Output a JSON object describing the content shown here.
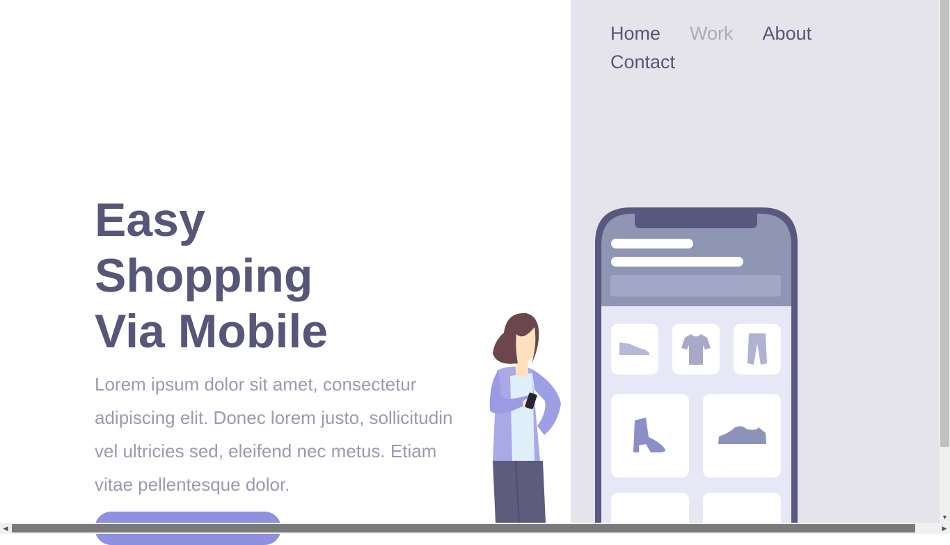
{
  "nav": {
    "items": [
      {
        "label": "Home",
        "active": false
      },
      {
        "label": "Work",
        "active": true
      },
      {
        "label": "About",
        "active": false
      },
      {
        "label": "Contact",
        "active": false
      }
    ]
  },
  "hero": {
    "headline_lines": [
      "Easy",
      "Shopping",
      "Via Mobile"
    ],
    "description": "Lorem ipsum dolor sit amet, consectetur adipiscing elit. Donec lorem justo, sollicitudin vel ultricies sed, eleifend nec metus. Etiam vitae pellentesque dolor."
  },
  "illustration": {
    "icons": [
      "shoe-icon",
      "t-shirt-icon",
      "pants-icon",
      "boot-icon",
      "sneaker-icon"
    ]
  },
  "colors": {
    "primary_text": "#565678",
    "muted_text": "#9a9aae",
    "panel_bg": "#e5e4ea",
    "accent": "#8f90e0",
    "active_nav": "#aaaabc"
  }
}
